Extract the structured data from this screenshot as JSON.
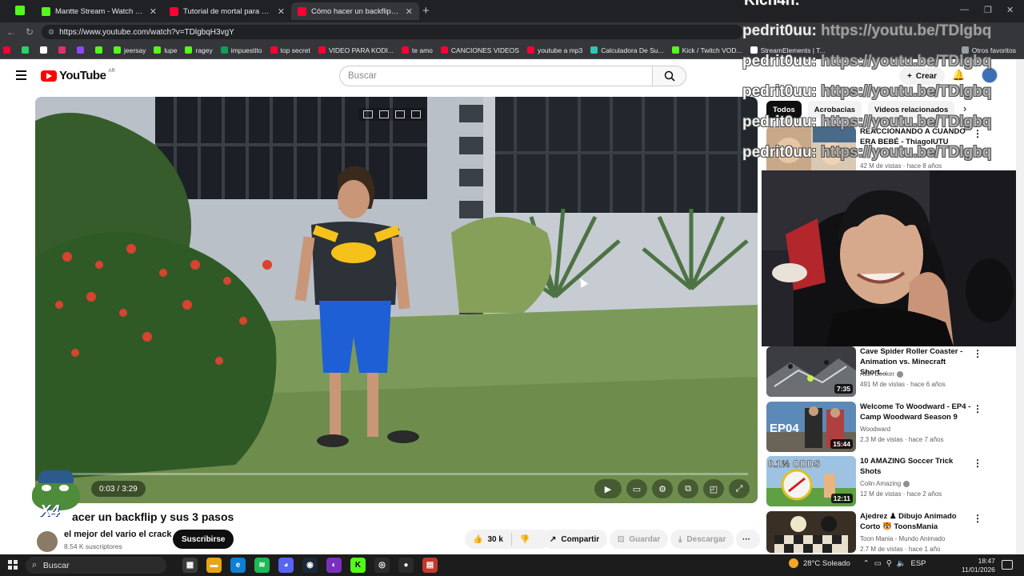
{
  "browser": {
    "tabs": [
      {
        "title": "Mantte Stream - Watch Live o",
        "icon_color": "#53fc18",
        "active": false
      },
      {
        "title": "Tutorial de mortal para atrás! 🔥 Al",
        "icon_color": "#ff0033",
        "active": false
      },
      {
        "title": "Cómo hacer un backflip y sus",
        "icon_color": "#ff0033",
        "active": true
      }
    ],
    "new_tab": "+",
    "url": "https://www.youtube.com/watch?v=TDlgbqH3vgY",
    "bookmarks": [
      {
        "label": "",
        "color": "#ff0033"
      },
      {
        "label": "",
        "color": "#25d366"
      },
      {
        "label": "",
        "color": "#ffffff"
      },
      {
        "label": "",
        "color": "#e1306c"
      },
      {
        "label": "",
        "color": "#9146ff"
      },
      {
        "label": "",
        "color": "#53fc18"
      },
      {
        "label": "jeersay",
        "color": "#53fc18"
      },
      {
        "label": "lupe",
        "color": "#53fc18"
      },
      {
        "label": "ragey",
        "color": "#53fc18"
      },
      {
        "label": "impuestito",
        "color": "#0f9d58"
      },
      {
        "label": "top secret",
        "color": "#ff0033"
      },
      {
        "label": "VIDEO PARA KODI...",
        "color": "#ff0033"
      },
      {
        "label": "te amo",
        "color": "#ff0033"
      },
      {
        "label": "CANCIONES VIDEOS",
        "color": "#ff0033"
      },
      {
        "label": "youtube a mp3",
        "color": "#ff0033"
      },
      {
        "label": "Calculadora De Su...",
        "color": "#2ec4b6"
      },
      {
        "label": "Kick / Twitch VOD...",
        "color": "#53fc18"
      },
      {
        "label": "StreamElements | T...",
        "color": "#ffffff"
      },
      {
        "label": "Otros favoritos",
        "color": "#9aa0a6"
      }
    ]
  },
  "youtube": {
    "logo_text": "YouTube",
    "country_code": "AR",
    "search_placeholder": "Buscar",
    "create_label": "Crear",
    "player": {
      "time_current": "0:03",
      "time_sep": " / ",
      "time_total": "3:29",
      "progress": 0.015
    },
    "video": {
      "title": "Cómo hacer un backflip y sus 3 pasos",
      "title_visible": "acer un backflip y sus 3 pasos",
      "channel": "el mejor del vario el crack",
      "subscribers": "8.54 K suscriptores",
      "subscribe_label": "Suscribirse",
      "likes": "30 k",
      "share_label": "Compartir",
      "save_label": "Guardar",
      "download_label": "Descargar",
      "more_label": "···"
    },
    "chips": [
      "Todos",
      "Acrobacias",
      "Videos relacionados"
    ],
    "recommendations": [
      {
        "title": "REACCIONANDO A CUANDO ERA BEBÉ - ThiagoIUTU",
        "channel": "",
        "meta": "42 M de vistas · hace 8 años",
        "duration": "",
        "verified": false
      },
      {
        "title": "Cave Spider Roller Coaster - Animation vs. Minecraft Short...",
        "channel": "Alan Becker",
        "meta": "491 M de vistas · hace 6 años",
        "duration": "7:35",
        "verified": true
      },
      {
        "title": "Welcome To Woodward - EP4 - Camp Woodward Season 9",
        "channel": "Woodward",
        "meta": "2.3 M de vistas · hace 7 años",
        "duration": "15:44",
        "verified": false
      },
      {
        "title": "10 AMAZING Soccer Trick Shots",
        "channel": "Colin Amazing",
        "meta": "12 M de vistas · hace 2 años",
        "duration": "12:11",
        "verified": true
      },
      {
        "title": "Ajedrez ♟ Dibujo Animado Corto 🐯 ToonsMania",
        "channel": "Toon Mania - Mundo Animado",
        "meta": "2.7 M de vistas · hace 1 año",
        "duration": "",
        "verified": false
      }
    ]
  },
  "overlay": {
    "chat_top": "Kich4n:",
    "chat_user": "pedrit0uu:",
    "chat_link": "https://youtu.be/TDlgbq",
    "pepe_text": "X4"
  },
  "taskbar": {
    "search_label": "Buscar",
    "weather": "28°C  Soleado",
    "lang": "ESP",
    "time": "18:47",
    "date": "11/01/2026"
  }
}
